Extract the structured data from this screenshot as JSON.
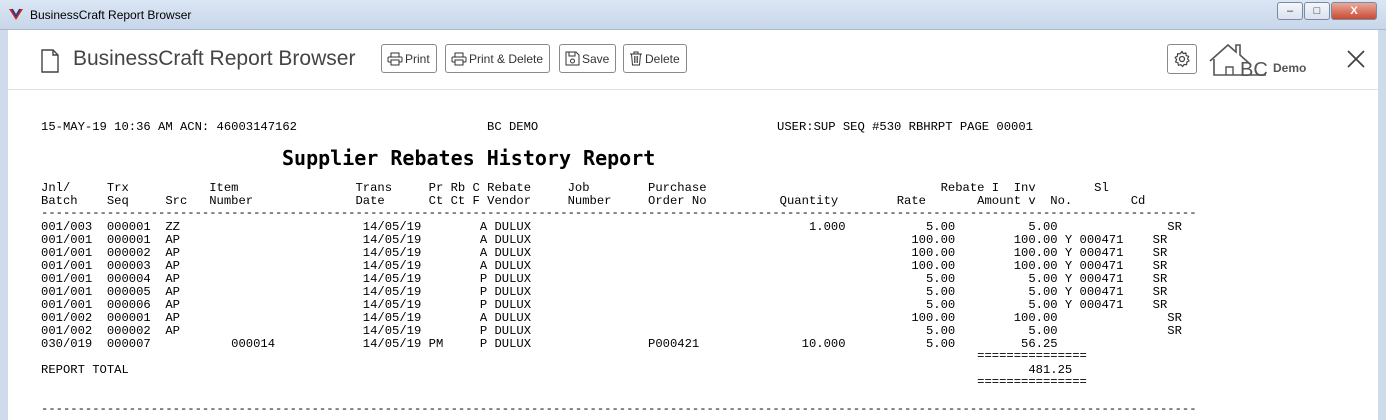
{
  "window": {
    "title": "BusinessCraft Report Browser",
    "minimize": "‒",
    "maximize": "□",
    "close": "X"
  },
  "toolbar": {
    "app_title": "BusinessCraft Report Browser",
    "print_label": "Print",
    "print_delete_label": "Print & Delete",
    "save_label": "Save",
    "delete_label": "Delete",
    "logo_text": "Demo",
    "logo_letters": "BC"
  },
  "report": {
    "header_left": "15-MAY-19 10:36 AM ACN: 46003147162",
    "header_center": "BC DEMO",
    "header_right": "USER:SUP SEQ #530 RBHRPT PAGE 00001",
    "title": "Supplier Rebates History Report",
    "col_header_1": "Jnl/     Trx           Item                Trans     Pr Rb C Rebate     Job        Purchase                                Rebate I  Inv        Sl",
    "col_header_2": "Batch    Seq     Src   Number              Date      Ct Ct F Vendor     Number     Order No          Quantity        Rate       Amount v  No.        Cd",
    "rule": "--------------------------------------------------------------------------------------------------------------------------------------------------------------",
    "rows": [
      "001/003  000001  ZZ                         14/05/19        A DULUX                                      1.000           5.00          5.00               SR",
      "001/001  000001  AP                         14/05/19        A DULUX                                                    100.00        100.00 Y 000471    SR",
      "001/001  000002  AP                         14/05/19        A DULUX                                                    100.00        100.00 Y 000471    SR",
      "001/001  000003  AP                         14/05/19        A DULUX                                                    100.00        100.00 Y 000471    SR",
      "001/001  000004  AP                         14/05/19        P DULUX                                                      5.00          5.00 Y 000471    SR",
      "001/001  000005  AP                         14/05/19        P DULUX                                                      5.00          5.00 Y 000471    SR",
      "001/001  000006  AP                         14/05/19        P DULUX                                                      5.00          5.00 Y 000471    SR",
      "001/002  000001  AP                         14/05/19        A DULUX                                                    100.00        100.00               SR",
      "001/002  000002  AP                         14/05/19        P DULUX                                                      5.00          5.00               SR",
      "030/019  000007           000014            14/05/19 PM     P DULUX                P000421              10.000           5.00         56.25"
    ],
    "total_rule_top": "                                                                                                                                ===============",
    "total_line": "REPORT TOTAL                                                                                                                           481.25",
    "total_rule_bottom": "                                                                                                                                ===============",
    "footer_rule": "--------------------------------------------------------------------------------------------------------------------------------------------------------------"
  },
  "icons": {
    "app": "app-logo-icon",
    "doc": "document-icon",
    "print": "printer-icon",
    "save": "save-icon",
    "delete": "trash-icon",
    "settings": "gear-icon",
    "close": "close-icon"
  }
}
